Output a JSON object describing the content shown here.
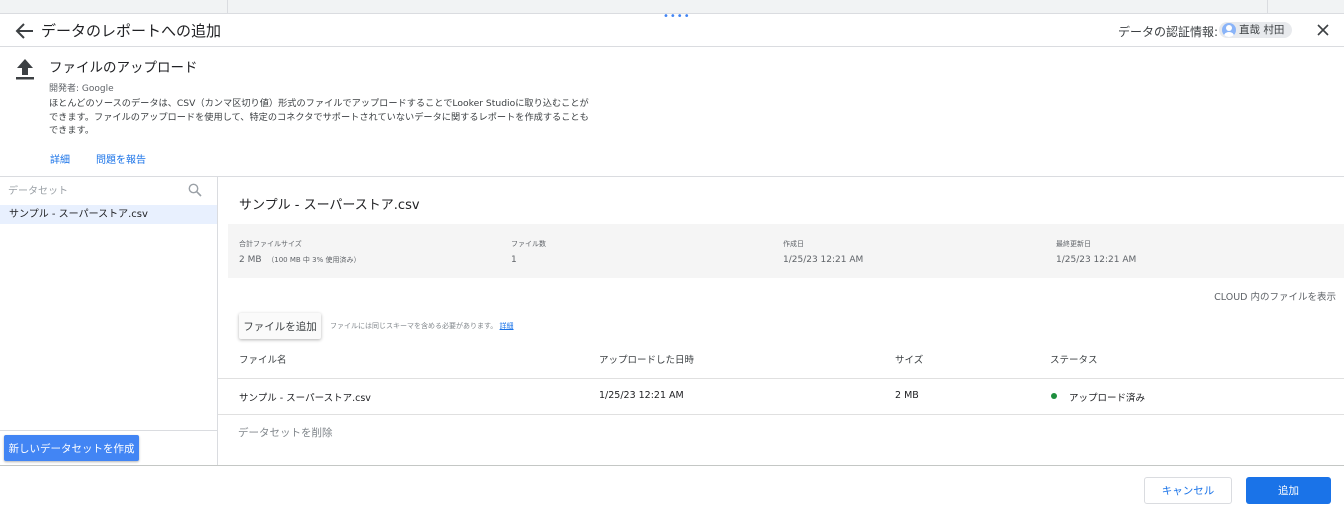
{
  "window": {
    "title": "データのレポートへの追加",
    "credentials_label": "データの認証情報:",
    "user_name": "直哉 村田",
    "drag_handle": "••••"
  },
  "connector": {
    "name": "ファイルのアップロード",
    "developer": "開発者: Google",
    "description": "ほとんどのソースのデータは、CSV（カンマ区切り値）形式のファイルでアップロードすることでLooker Studioに取り込むことができます。ファイルのアップロードを使用して、特定のコネクタでサポートされていないデータに関するレポートを作成することもできます。",
    "links": {
      "details": "詳細",
      "report_issue": "問題を報告"
    }
  },
  "sidebar": {
    "search_placeholder": "データセット",
    "items": [
      {
        "label": "サンプル - スーパーストア.csv",
        "selected": true
      }
    ],
    "create_button": "新しいデータセットを作成"
  },
  "dataset": {
    "title": "サンプル - スーパーストア.csv",
    "stats": {
      "total_size_label": "合計ファイルサイズ",
      "total_size_value": "2 MB",
      "total_size_note": "（100 MB 中 3% 使用済み）",
      "file_count_label": "ファイル数",
      "file_count_value": "1",
      "created_label": "作成日",
      "created_value": "1/25/23 12:21 AM",
      "updated_label": "最終更新日",
      "updated_value": "1/25/23 12:21 AM"
    },
    "cloud_link": "CLOUD 内のファイルを表示",
    "add_file_button": "ファイルを追加",
    "schema_note": "ファイルには同じスキーマを含める必要があります。",
    "schema_note_link": "詳細",
    "table": {
      "headers": [
        "ファイル名",
        "アップロードした日時",
        "サイズ",
        "ステータス"
      ],
      "rows": [
        {
          "file_name": "サンプル - スーパーストア.csv",
          "uploaded": "1/25/23 12:21 AM",
          "size": "2 MB",
          "status": "アップロード済み",
          "status_color": "#1e8e3e"
        }
      ]
    },
    "delete_label": "データセットを削除"
  },
  "footer": {
    "cancel": "キャンセル",
    "add": "追加"
  },
  "colors": {
    "accent": "#1a73e8",
    "create_button": "#4285f4",
    "selected_item": "#e8f0fe",
    "status_ok": "#1e8e3e"
  }
}
